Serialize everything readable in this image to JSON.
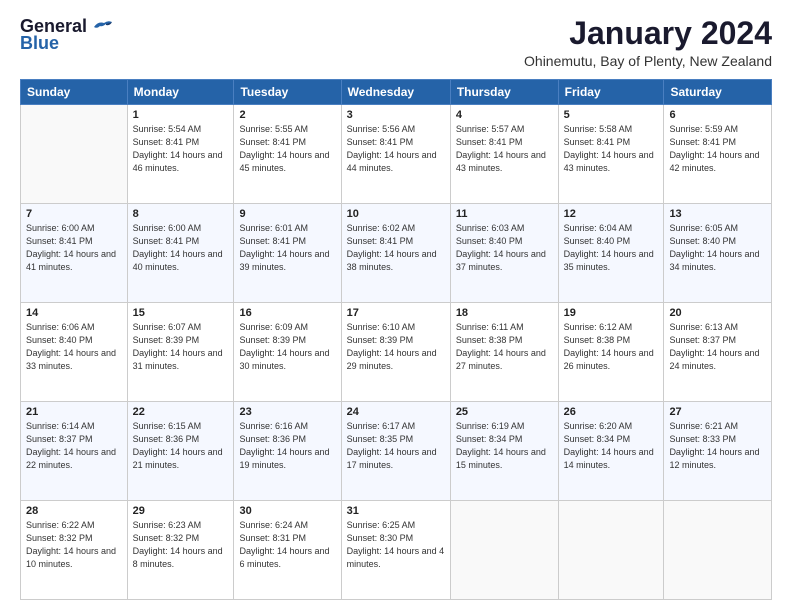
{
  "logo": {
    "line1": "General",
    "line2": "Blue"
  },
  "header": {
    "month": "January 2024",
    "location": "Ohinemutu, Bay of Plenty, New Zealand"
  },
  "columns": [
    "Sunday",
    "Monday",
    "Tuesday",
    "Wednesday",
    "Thursday",
    "Friday",
    "Saturday"
  ],
  "weeks": [
    [
      {
        "day": "",
        "info": ""
      },
      {
        "day": "1",
        "info": "Sunrise: 5:54 AM\nSunset: 8:41 PM\nDaylight: 14 hours\nand 46 minutes."
      },
      {
        "day": "2",
        "info": "Sunrise: 5:55 AM\nSunset: 8:41 PM\nDaylight: 14 hours\nand 45 minutes."
      },
      {
        "day": "3",
        "info": "Sunrise: 5:56 AM\nSunset: 8:41 PM\nDaylight: 14 hours\nand 44 minutes."
      },
      {
        "day": "4",
        "info": "Sunrise: 5:57 AM\nSunset: 8:41 PM\nDaylight: 14 hours\nand 43 minutes."
      },
      {
        "day": "5",
        "info": "Sunrise: 5:58 AM\nSunset: 8:41 PM\nDaylight: 14 hours\nand 43 minutes."
      },
      {
        "day": "6",
        "info": "Sunrise: 5:59 AM\nSunset: 8:41 PM\nDaylight: 14 hours\nand 42 minutes."
      }
    ],
    [
      {
        "day": "7",
        "info": "Sunrise: 6:00 AM\nSunset: 8:41 PM\nDaylight: 14 hours\nand 41 minutes."
      },
      {
        "day": "8",
        "info": "Sunrise: 6:00 AM\nSunset: 8:41 PM\nDaylight: 14 hours\nand 40 minutes."
      },
      {
        "day": "9",
        "info": "Sunrise: 6:01 AM\nSunset: 8:41 PM\nDaylight: 14 hours\nand 39 minutes."
      },
      {
        "day": "10",
        "info": "Sunrise: 6:02 AM\nSunset: 8:41 PM\nDaylight: 14 hours\nand 38 minutes."
      },
      {
        "day": "11",
        "info": "Sunrise: 6:03 AM\nSunset: 8:40 PM\nDaylight: 14 hours\nand 37 minutes."
      },
      {
        "day": "12",
        "info": "Sunrise: 6:04 AM\nSunset: 8:40 PM\nDaylight: 14 hours\nand 35 minutes."
      },
      {
        "day": "13",
        "info": "Sunrise: 6:05 AM\nSunset: 8:40 PM\nDaylight: 14 hours\nand 34 minutes."
      }
    ],
    [
      {
        "day": "14",
        "info": "Sunrise: 6:06 AM\nSunset: 8:40 PM\nDaylight: 14 hours\nand 33 minutes."
      },
      {
        "day": "15",
        "info": "Sunrise: 6:07 AM\nSunset: 8:39 PM\nDaylight: 14 hours\nand 31 minutes."
      },
      {
        "day": "16",
        "info": "Sunrise: 6:09 AM\nSunset: 8:39 PM\nDaylight: 14 hours\nand 30 minutes."
      },
      {
        "day": "17",
        "info": "Sunrise: 6:10 AM\nSunset: 8:39 PM\nDaylight: 14 hours\nand 29 minutes."
      },
      {
        "day": "18",
        "info": "Sunrise: 6:11 AM\nSunset: 8:38 PM\nDaylight: 14 hours\nand 27 minutes."
      },
      {
        "day": "19",
        "info": "Sunrise: 6:12 AM\nSunset: 8:38 PM\nDaylight: 14 hours\nand 26 minutes."
      },
      {
        "day": "20",
        "info": "Sunrise: 6:13 AM\nSunset: 8:37 PM\nDaylight: 14 hours\nand 24 minutes."
      }
    ],
    [
      {
        "day": "21",
        "info": "Sunrise: 6:14 AM\nSunset: 8:37 PM\nDaylight: 14 hours\nand 22 minutes."
      },
      {
        "day": "22",
        "info": "Sunrise: 6:15 AM\nSunset: 8:36 PM\nDaylight: 14 hours\nand 21 minutes."
      },
      {
        "day": "23",
        "info": "Sunrise: 6:16 AM\nSunset: 8:36 PM\nDaylight: 14 hours\nand 19 minutes."
      },
      {
        "day": "24",
        "info": "Sunrise: 6:17 AM\nSunset: 8:35 PM\nDaylight: 14 hours\nand 17 minutes."
      },
      {
        "day": "25",
        "info": "Sunrise: 6:19 AM\nSunset: 8:34 PM\nDaylight: 14 hours\nand 15 minutes."
      },
      {
        "day": "26",
        "info": "Sunrise: 6:20 AM\nSunset: 8:34 PM\nDaylight: 14 hours\nand 14 minutes."
      },
      {
        "day": "27",
        "info": "Sunrise: 6:21 AM\nSunset: 8:33 PM\nDaylight: 14 hours\nand 12 minutes."
      }
    ],
    [
      {
        "day": "28",
        "info": "Sunrise: 6:22 AM\nSunset: 8:32 PM\nDaylight: 14 hours\nand 10 minutes."
      },
      {
        "day": "29",
        "info": "Sunrise: 6:23 AM\nSunset: 8:32 PM\nDaylight: 14 hours\nand 8 minutes."
      },
      {
        "day": "30",
        "info": "Sunrise: 6:24 AM\nSunset: 8:31 PM\nDaylight: 14 hours\nand 6 minutes."
      },
      {
        "day": "31",
        "info": "Sunrise: 6:25 AM\nSunset: 8:30 PM\nDaylight: 14 hours\nand 4 minutes."
      },
      {
        "day": "",
        "info": ""
      },
      {
        "day": "",
        "info": ""
      },
      {
        "day": "",
        "info": ""
      }
    ]
  ]
}
